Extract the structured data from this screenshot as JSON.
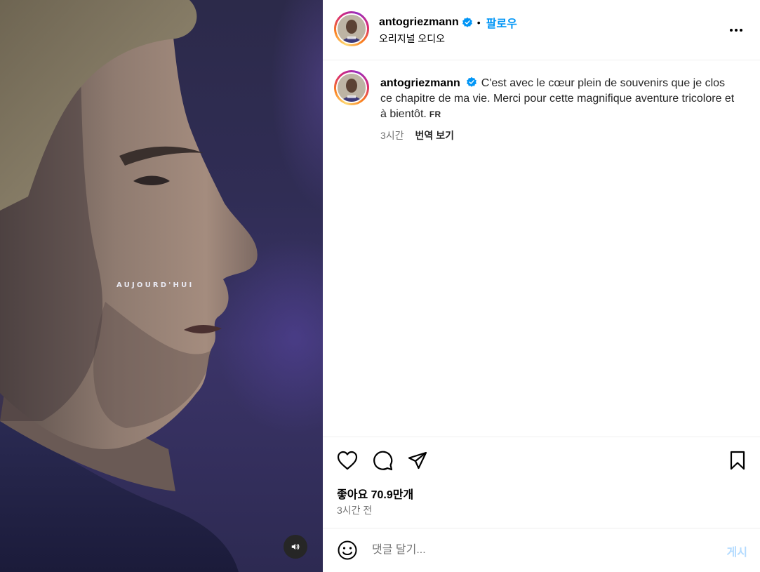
{
  "media": {
    "overlay_text": "AUJOURD'HUI",
    "sound_icon": "speaker-icon"
  },
  "header": {
    "username": "antogriezmann",
    "verified_icon": "verified-badge-icon",
    "separator": "•",
    "follow_label": "팔로우",
    "audio_label": "오리지널 오디오",
    "more_icon": "more-options-icon"
  },
  "caption": {
    "username": "antogriezmann",
    "text": "C'est avec le cœur plein de souvenirs que je clos ce chapitre de ma vie. Merci pour cette magnifique aventure tricolore et à bientôt.",
    "language": "FR",
    "time": "3시간",
    "translate_label": "번역 보기"
  },
  "actions": {
    "like_icon": "heart-icon",
    "comment_icon": "comment-icon",
    "share_icon": "share-icon",
    "save_icon": "bookmark-icon",
    "likes_text": "좋아요 70.9만개",
    "posted_time": "3시간 전"
  },
  "comment": {
    "emoji_icon": "emoji-icon",
    "placeholder": "댓글 달기...",
    "post_label": "게시"
  },
  "colors": {
    "accent": "#0095f6",
    "post_disabled": "#b3dbff",
    "muted": "#737373"
  }
}
